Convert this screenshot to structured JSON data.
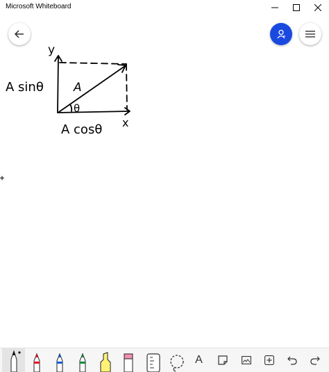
{
  "window": {
    "title": "Microsoft Whiteboard",
    "controls": [
      "minimize-icon",
      "maximize-icon",
      "close-icon"
    ]
  },
  "header": {
    "back_icon": "back-arrow-icon",
    "profile_icon": "person-icon",
    "menu_icon": "hamburger-menu-icon",
    "accent": "#1a49e0"
  },
  "drawing": {
    "label_y": "y",
    "label_x": "x",
    "label_vector": "A",
    "label_angle": "θ",
    "label_vertical_component": "A sinθ",
    "label_horizontal_component": "A cosθ",
    "ink_color": "#000000"
  },
  "toolbar": {
    "tools": [
      {
        "name": "black pen",
        "color": "#111111",
        "icon": "pen-icon",
        "selected": true
      },
      {
        "name": "red pen",
        "color": "#e81123",
        "icon": "pen-icon"
      },
      {
        "name": "blue pen",
        "color": "#0a5bd6",
        "icon": "pen-icon"
      },
      {
        "name": "green pen",
        "color": "#0f8a3c",
        "icon": "pen-icon"
      },
      {
        "name": "yellow highlighter",
        "color": "#fff176",
        "icon": "highlighter-icon"
      },
      {
        "name": "pink highlighter",
        "color": "#f48fb1",
        "icon": "highlighter-icon"
      },
      {
        "name": "ruler",
        "icon": "ruler-icon"
      },
      {
        "name": "lasso",
        "icon": "lasso-icon"
      },
      {
        "name": "text",
        "glyph": "A",
        "icon": "text-icon"
      },
      {
        "name": "note",
        "icon": "note-icon"
      },
      {
        "name": "image",
        "icon": "image-icon"
      },
      {
        "name": "insert",
        "icon": "insert-plus-icon"
      },
      {
        "name": "undo",
        "icon": "undo-icon"
      },
      {
        "name": "redo",
        "icon": "redo-icon"
      }
    ]
  }
}
